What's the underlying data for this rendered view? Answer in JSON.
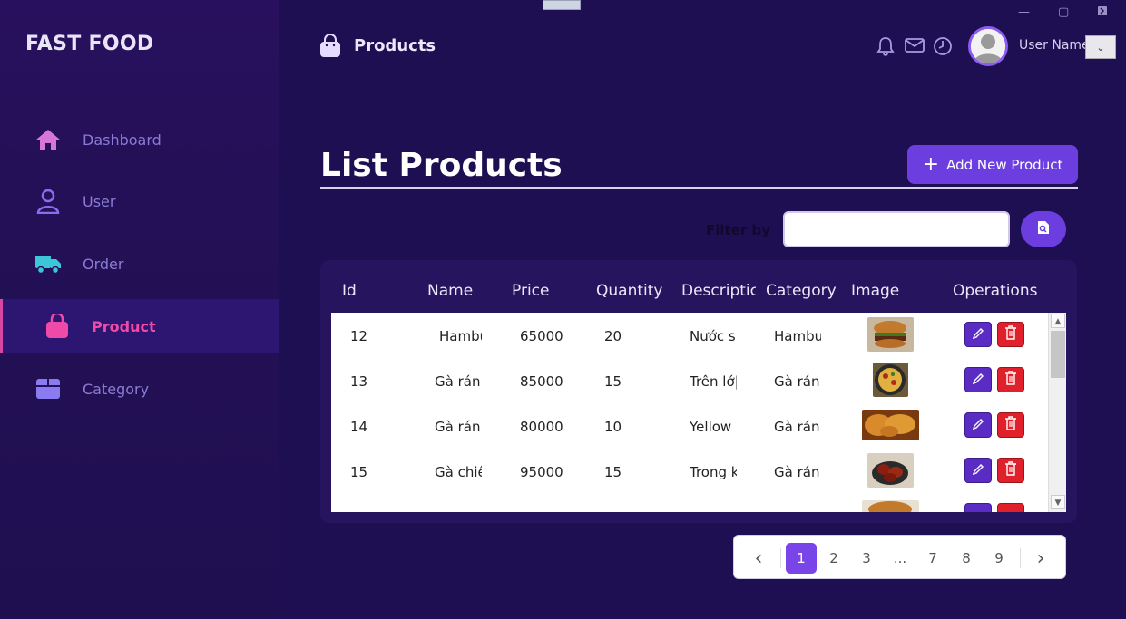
{
  "brand": "FAST FOOD",
  "sidebar": {
    "items": [
      {
        "label": "Dashboard",
        "icon": "home-icon"
      },
      {
        "label": "User",
        "icon": "user-icon"
      },
      {
        "label": "Order",
        "icon": "truck-icon"
      },
      {
        "label": "Product",
        "icon": "shopping-bag-icon",
        "active": true
      },
      {
        "label": "Category",
        "icon": "box-icon"
      }
    ]
  },
  "header": {
    "title": "Products",
    "icons": [
      "bell-icon",
      "mail-icon",
      "clock-icon"
    ],
    "username": "User Name"
  },
  "main": {
    "title": "List Products",
    "add_button": "Add New Product",
    "filter_label": "Filter by",
    "filter_value": ""
  },
  "table": {
    "columns": [
      "Id",
      "Name",
      "Price",
      "Quantity",
      "Descriptic",
      "Category",
      "Image",
      "Operations"
    ],
    "rows": [
      {
        "id": "12",
        "name": "Hambu",
        "price": "65000",
        "quantity": "20",
        "description": "Nước s",
        "category": "Hambu"
      },
      {
        "id": "13",
        "name": "Gà rán",
        "price": "85000",
        "quantity": "15",
        "description": "Trên lớ|",
        "category": "Gà rán"
      },
      {
        "id": "14",
        "name": "Gà rán",
        "price": "80000",
        "quantity": "10",
        "description": "Yellow",
        "category": "Gà rán"
      },
      {
        "id": "15",
        "name": "Gà chiê",
        "price": "95000",
        "quantity": "15",
        "description": "Trong k",
        "category": "Gà rán"
      }
    ]
  },
  "pagination": {
    "prev": "‹",
    "next": "›",
    "pages": [
      "1",
      "2",
      "3",
      "...",
      "7",
      "8",
      "9"
    ],
    "active": "1"
  },
  "colors": {
    "background": "#1e0f52",
    "sidebar": "#241057",
    "accent": "#6c3ee0",
    "active_nav": "#f04aa8",
    "delete": "#e0202a"
  }
}
